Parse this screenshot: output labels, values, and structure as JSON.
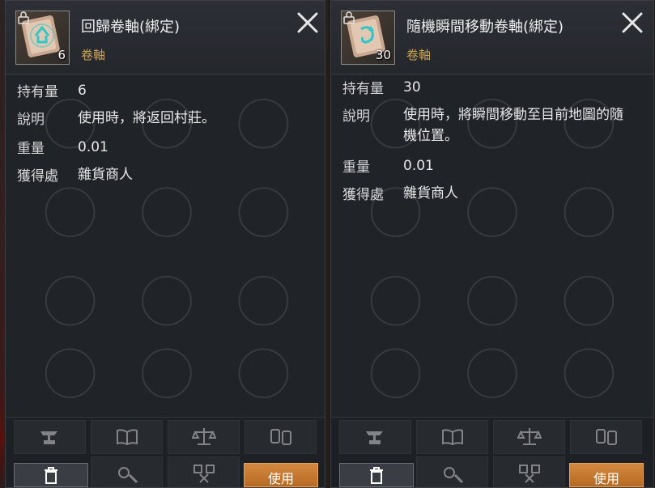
{
  "panels": [
    {
      "title": "回歸卷軸(綁定)",
      "subtype": "卷軸",
      "quantity_badge": "6",
      "rows": [
        {
          "label": "持有量",
          "value": "6"
        },
        {
          "label": "說明",
          "value": "使用時，將返回村莊。"
        },
        {
          "label": "重量",
          "value": "0.01"
        },
        {
          "label": "獲得處",
          "value": "雜貨商人"
        }
      ],
      "use_label": "使用"
    },
    {
      "title": "隨機瞬間移動卷軸(綁定)",
      "subtype": "卷軸",
      "quantity_badge": "30",
      "rows": [
        {
          "label": "持有量",
          "value": "30"
        },
        {
          "label": "說明",
          "value": "使用時，將瞬間移動至目前地圖的隨機位置。"
        },
        {
          "label": "重量",
          "value": "0.01"
        },
        {
          "label": "獲得處",
          "value": "雜貨商人"
        }
      ],
      "use_label": "使用"
    }
  ],
  "colors": {
    "panel_bg": "#22252a",
    "subtype_gold": "#c9a25a",
    "use_button": "#c77a30"
  },
  "icons": [
    "scroll-return-icon",
    "scroll-teleport-icon",
    "lock-icon",
    "close-icon",
    "anvil-icon",
    "book-icon",
    "scales-icon",
    "split-icon",
    "trash-icon",
    "gear-wrench-icon",
    "dismantle-icon"
  ]
}
